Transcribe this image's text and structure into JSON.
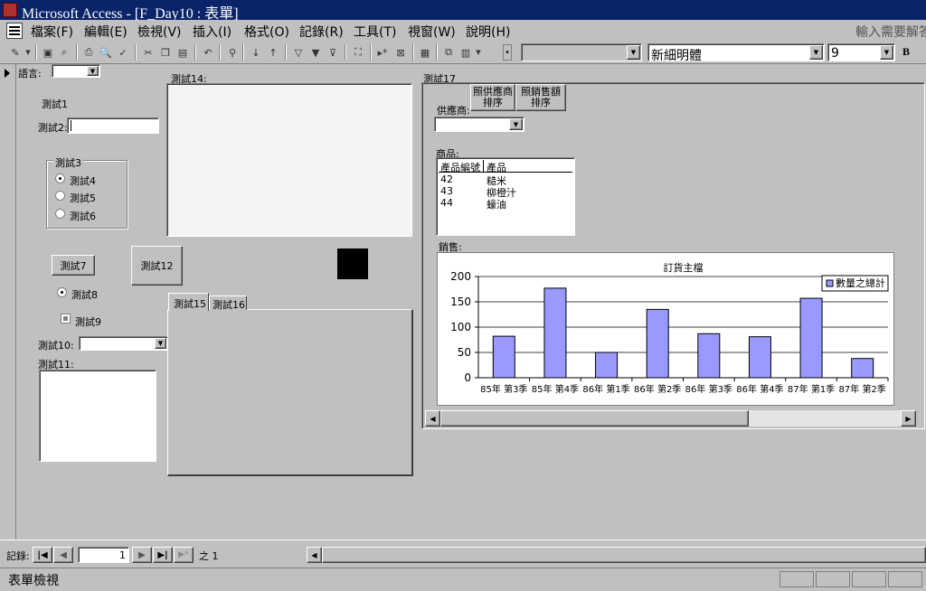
{
  "title_bar": {
    "title": "Microsoft Access - [F_Day10 : 表單]"
  },
  "menu": {
    "items": [
      "檔案(F)",
      "編輯(E)",
      "檢視(V)",
      "插入(I)",
      "格式(O)",
      "記錄(R)",
      "工具(T)",
      "視窗(W)",
      "說明(H)"
    ],
    "help_placeholder": "輸入需要解答"
  },
  "toolbar": {
    "font_name": "新細明體",
    "font_size": "9",
    "bold": "B"
  },
  "form": {
    "language_label": "語言:",
    "test1": "測試1",
    "test2_label": "測試2:",
    "test3_group": "測試3",
    "radios": [
      "測試4",
      "測試5",
      "測試6"
    ],
    "test7_button": "測試7",
    "test8_option": "測試8",
    "test9_check": "測試9",
    "test10_label": "測試10:",
    "test11_label": "測試11:",
    "test12_button": "測試12",
    "test14_label": "測試14:",
    "tabs": [
      "測試15",
      "測試16"
    ],
    "test17_label": "測試17",
    "sort_supplier": [
      "照供應商",
      "排序"
    ],
    "sort_sales": [
      "照銷售額",
      "排序"
    ],
    "supplier_label": "供應商:",
    "products_label": "商品:",
    "products": {
      "headers": [
        "產品編號",
        "產品"
      ],
      "rows": [
        [
          "42",
          "糙米"
        ],
        [
          "43",
          "柳橙汁"
        ],
        [
          "44",
          "蠔油"
        ]
      ]
    },
    "sales_label": "銷售:"
  },
  "chart_data": {
    "type": "bar",
    "title": "訂貨主檔",
    "categories": [
      "85年 第3季",
      "85年 第4季",
      "86年 第1季",
      "86年 第2季",
      "86年 第3季",
      "86年 第4季",
      "87年 第1季",
      "87年 第2季"
    ],
    "series": [
      {
        "name": "數量之總計",
        "values": [
          82,
          177,
          50,
          135,
          87,
          81,
          157,
          38
        ]
      }
    ],
    "ylim": [
      0,
      200
    ],
    "yticks": [
      0,
      50,
      100,
      150,
      200
    ],
    "grid": true,
    "legend": "top-right",
    "bar_color": "#9999ff"
  },
  "nav": {
    "record_label": "記錄:",
    "current": "1",
    "of_label": "之 1"
  },
  "status_bar": {
    "text": "表單檢視"
  }
}
